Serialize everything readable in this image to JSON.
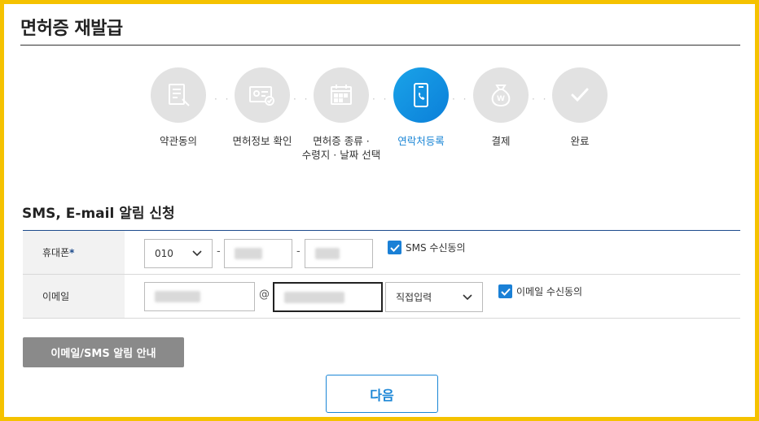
{
  "header": {
    "title": "면허증 재발급"
  },
  "steps": [
    {
      "label_line1": "약관동의",
      "label_line2": "",
      "icon": "document-pen-icon",
      "active": false
    },
    {
      "label_line1": "면허정보 확인",
      "label_line2": "",
      "icon": "id-card-check-icon",
      "active": false
    },
    {
      "label_line1": "면허증 종류 ·",
      "label_line2": "수령지 · 날짜 선택",
      "icon": "calendar-icon",
      "active": false
    },
    {
      "label_line1": "연락처등록",
      "label_line2": "",
      "icon": "phone-icon",
      "active": true
    },
    {
      "label_line1": "결제",
      "label_line2": "",
      "icon": "money-bag-icon",
      "active": false
    },
    {
      "label_line1": "완료",
      "label_line2": "",
      "icon": "check-icon",
      "active": false
    }
  ],
  "stepper_separator": "· ·",
  "section": {
    "title": "SMS, E-mail 알림 신청"
  },
  "phone_row": {
    "label": "휴대폰",
    "required_mark": "*",
    "prefix_value": "010",
    "dash": "-",
    "sms_consent_label": "SMS 수신동의",
    "sms_consent_checked": true
  },
  "email_row": {
    "label": "이메일",
    "at_sign": "@",
    "domain_select_value": "직접입력",
    "email_consent_label": "이메일 수신동의",
    "email_consent_checked": true
  },
  "buttons": {
    "guide": "이메일/SMS 알림 안내",
    "next": "다음"
  },
  "colors": {
    "frame": "#f5c200",
    "accent": "#1b86d6",
    "inactive_step": "#e2e2e2",
    "guide_button": "#8a8a8a"
  }
}
